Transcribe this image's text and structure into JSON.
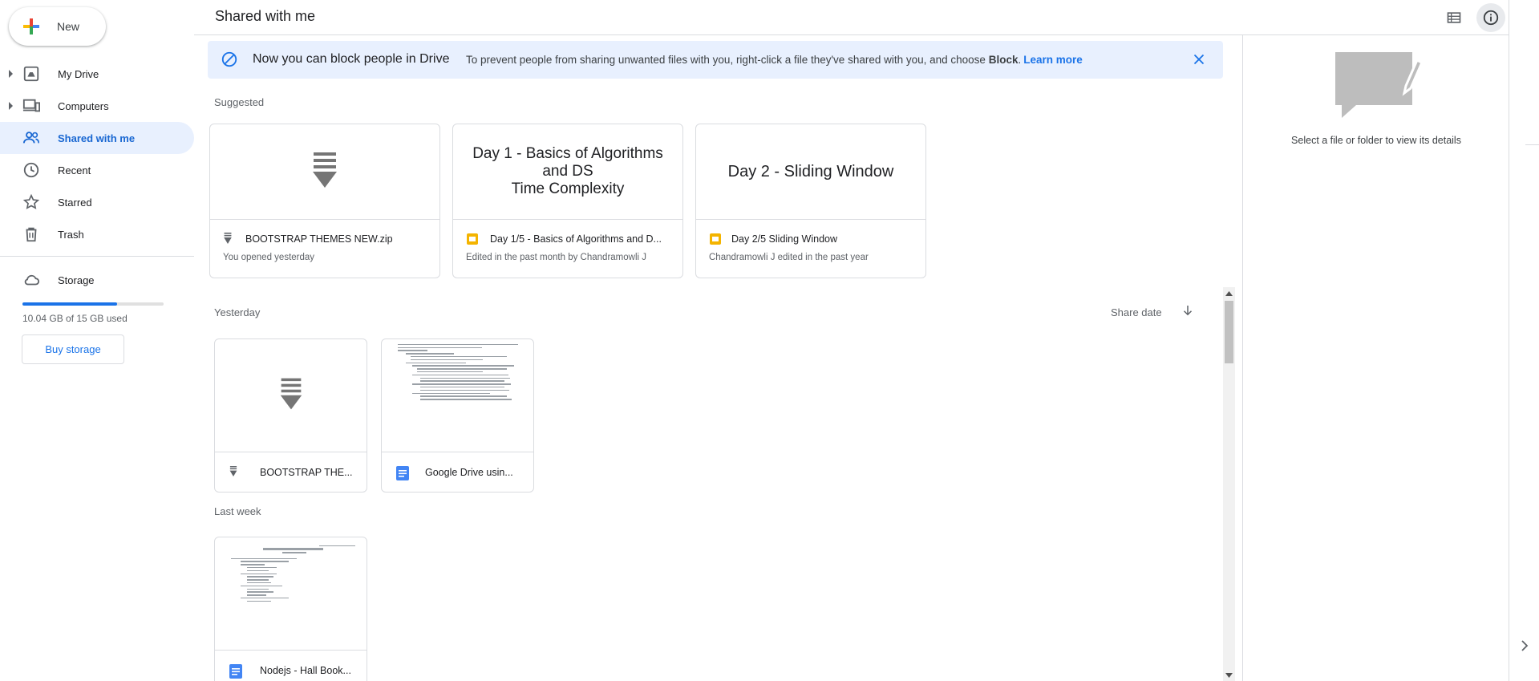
{
  "sidebar": {
    "new_label": "New",
    "items": [
      {
        "label": "My Drive"
      },
      {
        "label": "Computers"
      },
      {
        "label": "Shared with me"
      },
      {
        "label": "Recent"
      },
      {
        "label": "Starred"
      },
      {
        "label": "Trash"
      }
    ],
    "storage": {
      "label": "Storage",
      "used_text": "10.04 GB of 15 GB used",
      "used_fraction": 0.669,
      "buy_label": "Buy storage"
    }
  },
  "header": {
    "title": "Shared with me"
  },
  "banner": {
    "title": "Now you can block people in Drive",
    "text_before": "To prevent people from sharing unwanted files with you, right-click a file they've shared with you, and choose",
    "bold_word": "Block",
    "period": ".",
    "link": "Learn more"
  },
  "suggested": {
    "label": "Suggested",
    "cards": [
      {
        "thumb_text": "",
        "name": "BOOTSTRAP THEMES NEW.zip",
        "sub": "You opened yesterday",
        "icon": "zip-icon"
      },
      {
        "thumb_lines": [
          "Day 1 - Basics of Algorithms",
          "and DS",
          "Time Complexity"
        ],
        "name": "Day 1/5 - Basics of Algorithms and D...",
        "sub": "Edited in the past month by Chandramowli J",
        "icon": "slides-icon"
      },
      {
        "thumb_lines": [
          "Day 2 - Sliding Window"
        ],
        "name": "Day 2/5 Sliding Window",
        "sub": "Chandramowli J edited in the past year",
        "icon": "slides-icon"
      }
    ]
  },
  "sort": {
    "label": "Share date"
  },
  "groups": [
    {
      "label": "Yesterday",
      "files": [
        {
          "name": "BOOTSTRAP THE...",
          "icon": "zip-icon"
        },
        {
          "name": "Google Drive usin...",
          "icon": "docs-icon"
        }
      ]
    },
    {
      "label": "Last week",
      "files": [
        {
          "name": "Nodejs - Hall Book...",
          "icon": "docs-icon"
        }
      ]
    }
  ],
  "details": {
    "empty_text": "Select a file or folder to view its details"
  },
  "colors": {
    "accent": "#1a73e8",
    "active_bg": "#e8f0fe",
    "slides_yellow": "#f4b400",
    "docs_blue": "#4285f4"
  }
}
